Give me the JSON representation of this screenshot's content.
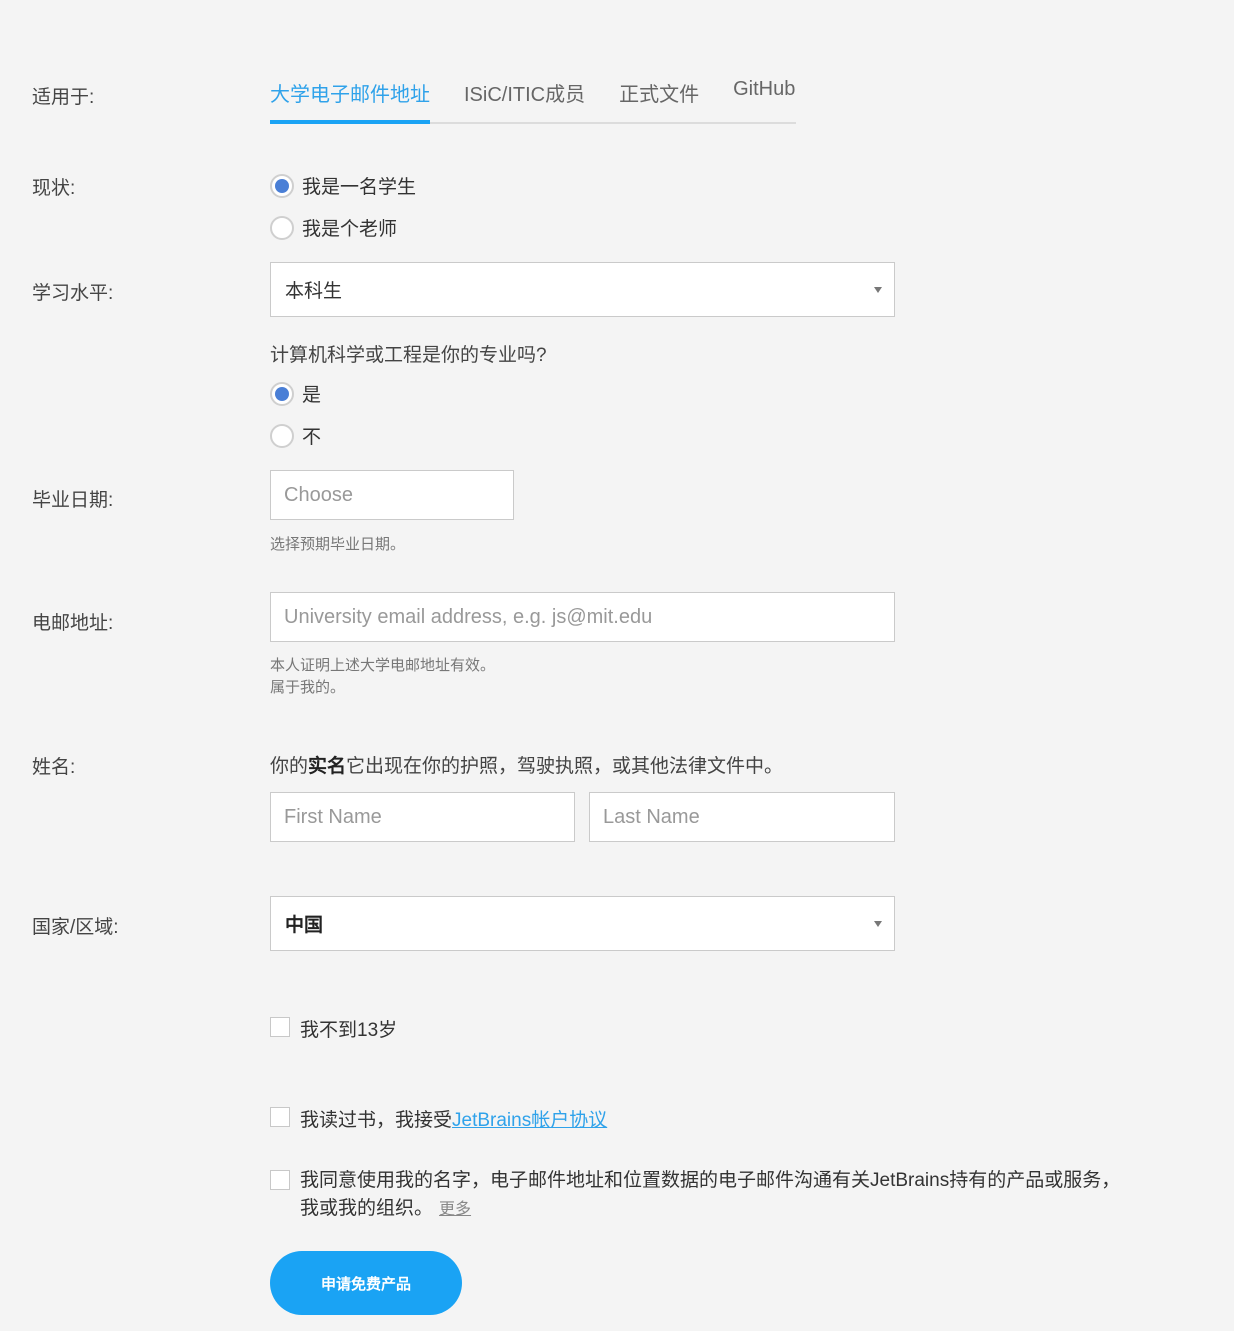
{
  "labels": {
    "applies_to": "适用于:",
    "status": "现状:",
    "study_level": "学习水平:",
    "graduation_date": "毕业日期:",
    "email": "电邮地址:",
    "name": "姓名:",
    "country": "国家/区域:"
  },
  "tabs": [
    {
      "label": "大学电子邮件地址",
      "active": true
    },
    {
      "label": "ISiC/ITIC成员",
      "active": false
    },
    {
      "label": "正式文件",
      "active": false
    },
    {
      "label": "GitHub",
      "active": false
    }
  ],
  "status_options": [
    {
      "label": "我是一名学生",
      "checked": true
    },
    {
      "label": "我是个老师",
      "checked": false
    }
  ],
  "study_level": {
    "selected": "本科生"
  },
  "cs_major": {
    "question": "计算机科学或工程是你的专业吗?",
    "options": [
      {
        "label": "是",
        "checked": true
      },
      {
        "label": "不",
        "checked": false
      }
    ]
  },
  "graduation": {
    "placeholder": "Choose",
    "hint": "选择预期毕业日期。"
  },
  "email": {
    "placeholder": "University email address, e.g. js@mit.edu",
    "hint_line1": "本人证明上述大学电邮地址有效。",
    "hint_line2": "属于我的。"
  },
  "name": {
    "prefix": "你的",
    "bold": "实名",
    "suffix": "它出现在你的护照，驾驶执照，或其他法律文件中。",
    "first_placeholder": "First Name",
    "last_placeholder": "Last Name"
  },
  "country": {
    "selected": "中国"
  },
  "checkboxes": {
    "under13": "我不到13岁",
    "agreement_prefix": "我读过书，我接受",
    "agreement_link": "JetBrains帐户协议",
    "consent_line1": "我同意使用我的名字，电子邮件地址和位置数据的电子邮件沟通有关JetBrains持有的产品或服务，",
    "consent_line2": "我或我的组织。",
    "consent_more": "更多"
  },
  "submit_label": "申请免费产品",
  "colors": {
    "accent": "#1aa3f4",
    "radio_fill": "#4a7fd6",
    "background": "#f4f4f4"
  }
}
